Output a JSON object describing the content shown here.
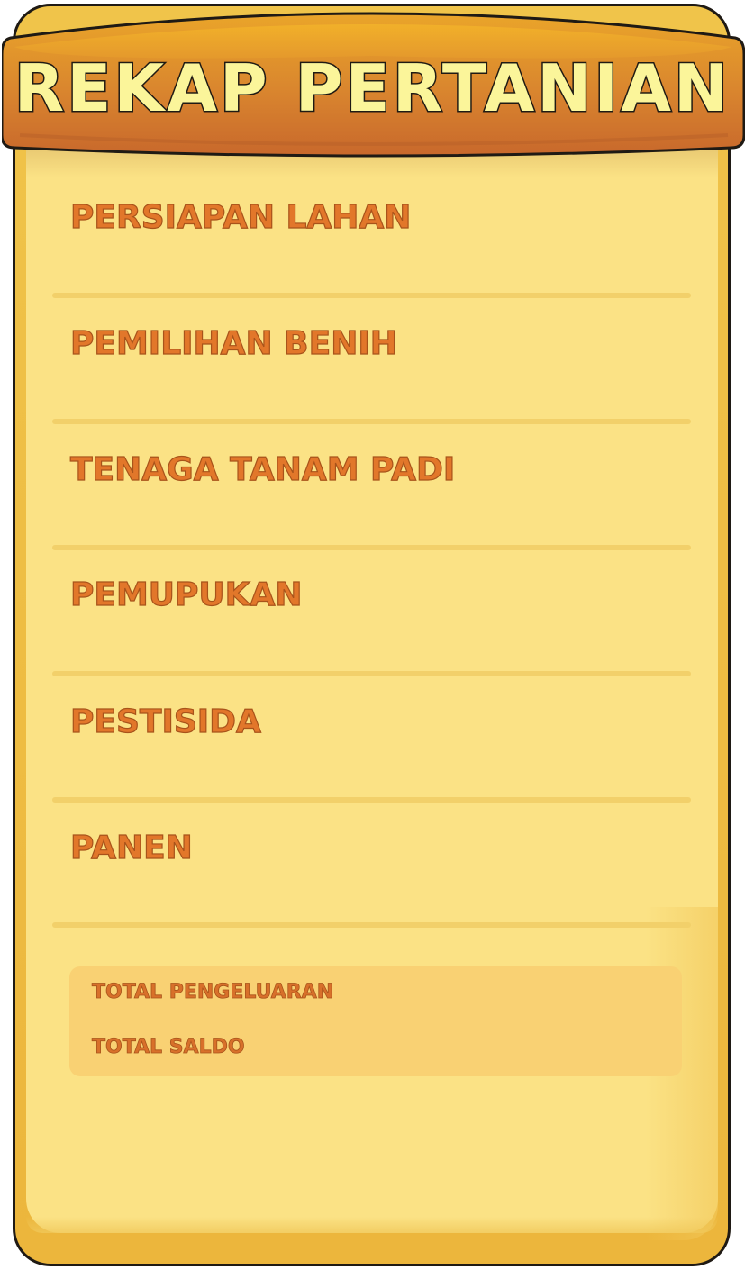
{
  "header": {
    "title": "REKAP PERTANIAN"
  },
  "rows": [
    {
      "label": "PERSIAPAN LAHAN"
    },
    {
      "label": "PEMILIHAN BENIH"
    },
    {
      "label": "TENAGA TANAM PADI"
    },
    {
      "label": "PEMUPUKAN"
    },
    {
      "label": "PESTISIDA"
    },
    {
      "label": "PANEN"
    }
  ],
  "totals": {
    "expense_label": "TOTAL PENGELUARAN",
    "balance_label": "TOTAL SALDO"
  },
  "colors": {
    "frame": "#ecb63c",
    "panel": "#fbe285",
    "banner": "#d9852e",
    "title_fill": "#fbf59a",
    "label_text": "#e2772a",
    "divider": "#f2d06a",
    "totals_box": "#f9d173"
  }
}
